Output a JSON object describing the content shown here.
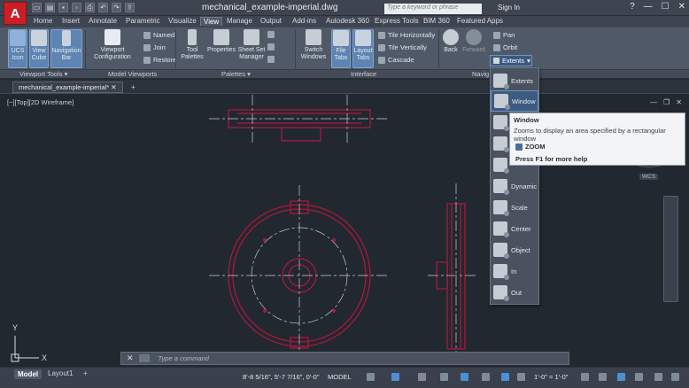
{
  "window": {
    "title": "mechanical_example-imperial.dwg",
    "search_placeholder": "Type a keyword or phrase",
    "sign_in": "Sign In",
    "help": "?",
    "minimize": "—",
    "maximize": "☐",
    "close": "✕"
  },
  "app": {
    "logo_letter": "A"
  },
  "ribbon_tabs": [
    "Home",
    "Insert",
    "Annotate",
    "Parametric",
    "Visualize",
    "View",
    "Manage",
    "Output",
    "Add-ins",
    "Autodesk 360",
    "Express Tools",
    "BIM 360",
    "Featured Apps"
  ],
  "active_tab": "View",
  "ribbon": {
    "ucs_icon": "UCS Icon",
    "view_cube": "View Cube",
    "navigation_bar": "Navigation Bar",
    "viewport_configuration": "Viewport Configuration",
    "named": "Named",
    "join": "Join",
    "restore": "Restore",
    "tool_palettes": "Tool Palettes",
    "properties": "Properties",
    "sheet_set_manager": "Sheet Set Manager",
    "switch_windows": "Switch Windows",
    "file_tabs": "File Tabs",
    "layout_tabs": "Layout Tabs",
    "tile_horizontally": "Tile Horizontally",
    "tile_vertically": "Tile Vertically",
    "cascade": "Cascade",
    "back": "Back",
    "forward": "Forward",
    "pan": "Pan",
    "orbit": "Orbit",
    "extents": "Extents",
    "groups": {
      "viewport_tools": "Viewport Tools ▾",
      "model_viewports": "Model Viewports",
      "palettes": "Palettes ▾",
      "interface": "Interface",
      "navigate": "Navig"
    }
  },
  "doc_tab": {
    "name": "mechanical_example-imperial*",
    "add": "+"
  },
  "viewport": {
    "label": "[−][Top][2D Wireframe]",
    "min": "—",
    "restore": "❐",
    "close": "✕",
    "wcs": "WCS",
    "ucs_x": "X",
    "ucs_y": "Y"
  },
  "zoom_menu": {
    "items": [
      "Extents",
      "Window",
      "Previous",
      "Realtime",
      "All",
      "Dynamic",
      "Scale",
      "Center",
      "Object",
      "In",
      "Out"
    ],
    "selected": "Window"
  },
  "tooltip": {
    "title": "Window",
    "description": "Zooms to display an area specified by a rectangular window",
    "command": "ZOOM",
    "help": "Press F1 for more help"
  },
  "command_line": {
    "placeholder": "Type a command",
    "close": "✕"
  },
  "status": {
    "model_tab": "Model",
    "layout_tab": "Layout1",
    "add_layout": "+",
    "coordinates": "8'-8 5/16\", 5'-7 7/16\", 0'-0\"",
    "space": "MODEL",
    "scale": "1'-0\" = 1'-0\""
  },
  "colors": {
    "drawing_lines": "#b3173d",
    "accent": "#4c8fd6",
    "background": "#212830"
  }
}
